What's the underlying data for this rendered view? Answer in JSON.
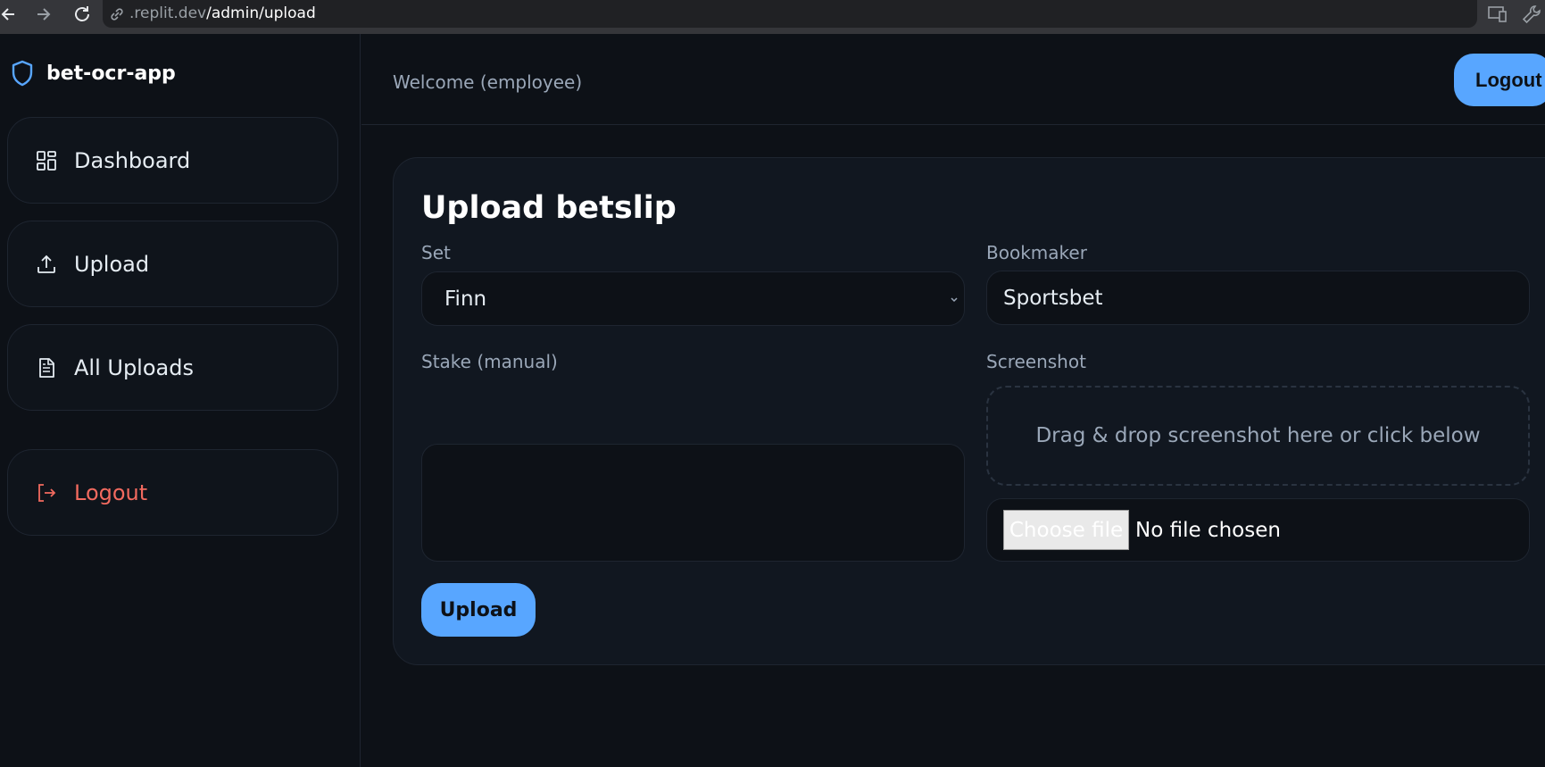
{
  "browser": {
    "url_prefix": ".replit.dev",
    "url_path": "/admin/upload"
  },
  "sidebar": {
    "brand": "bet-ocr-app",
    "items": [
      {
        "label": "Dashboard",
        "icon": "dashboard-icon"
      },
      {
        "label": "Upload",
        "icon": "upload-icon"
      },
      {
        "label": "All Uploads",
        "icon": "document-icon"
      },
      {
        "label": "Logout",
        "icon": "logout-icon"
      }
    ]
  },
  "header": {
    "welcome": "Welcome (employee)",
    "logout_label": "Logout"
  },
  "form": {
    "title": "Upload betslip",
    "set_label": "Set",
    "set_value": "Finn",
    "bookmaker_label": "Bookmaker",
    "bookmaker_value": "Sportsbet",
    "stake_label": "Stake (manual)",
    "stake_value": "",
    "screenshot_label": "Screenshot",
    "dropzone_text": "Drag & drop screenshot here or click below",
    "choose_file_label": "Choose file",
    "no_file_text": "No file chosen",
    "upload_label": "Upload"
  },
  "colors": {
    "background": "#0d1117",
    "card": "#111720",
    "accent": "#58a6ff",
    "danger": "#f26a5f",
    "muted_text": "#9aa7b8"
  }
}
